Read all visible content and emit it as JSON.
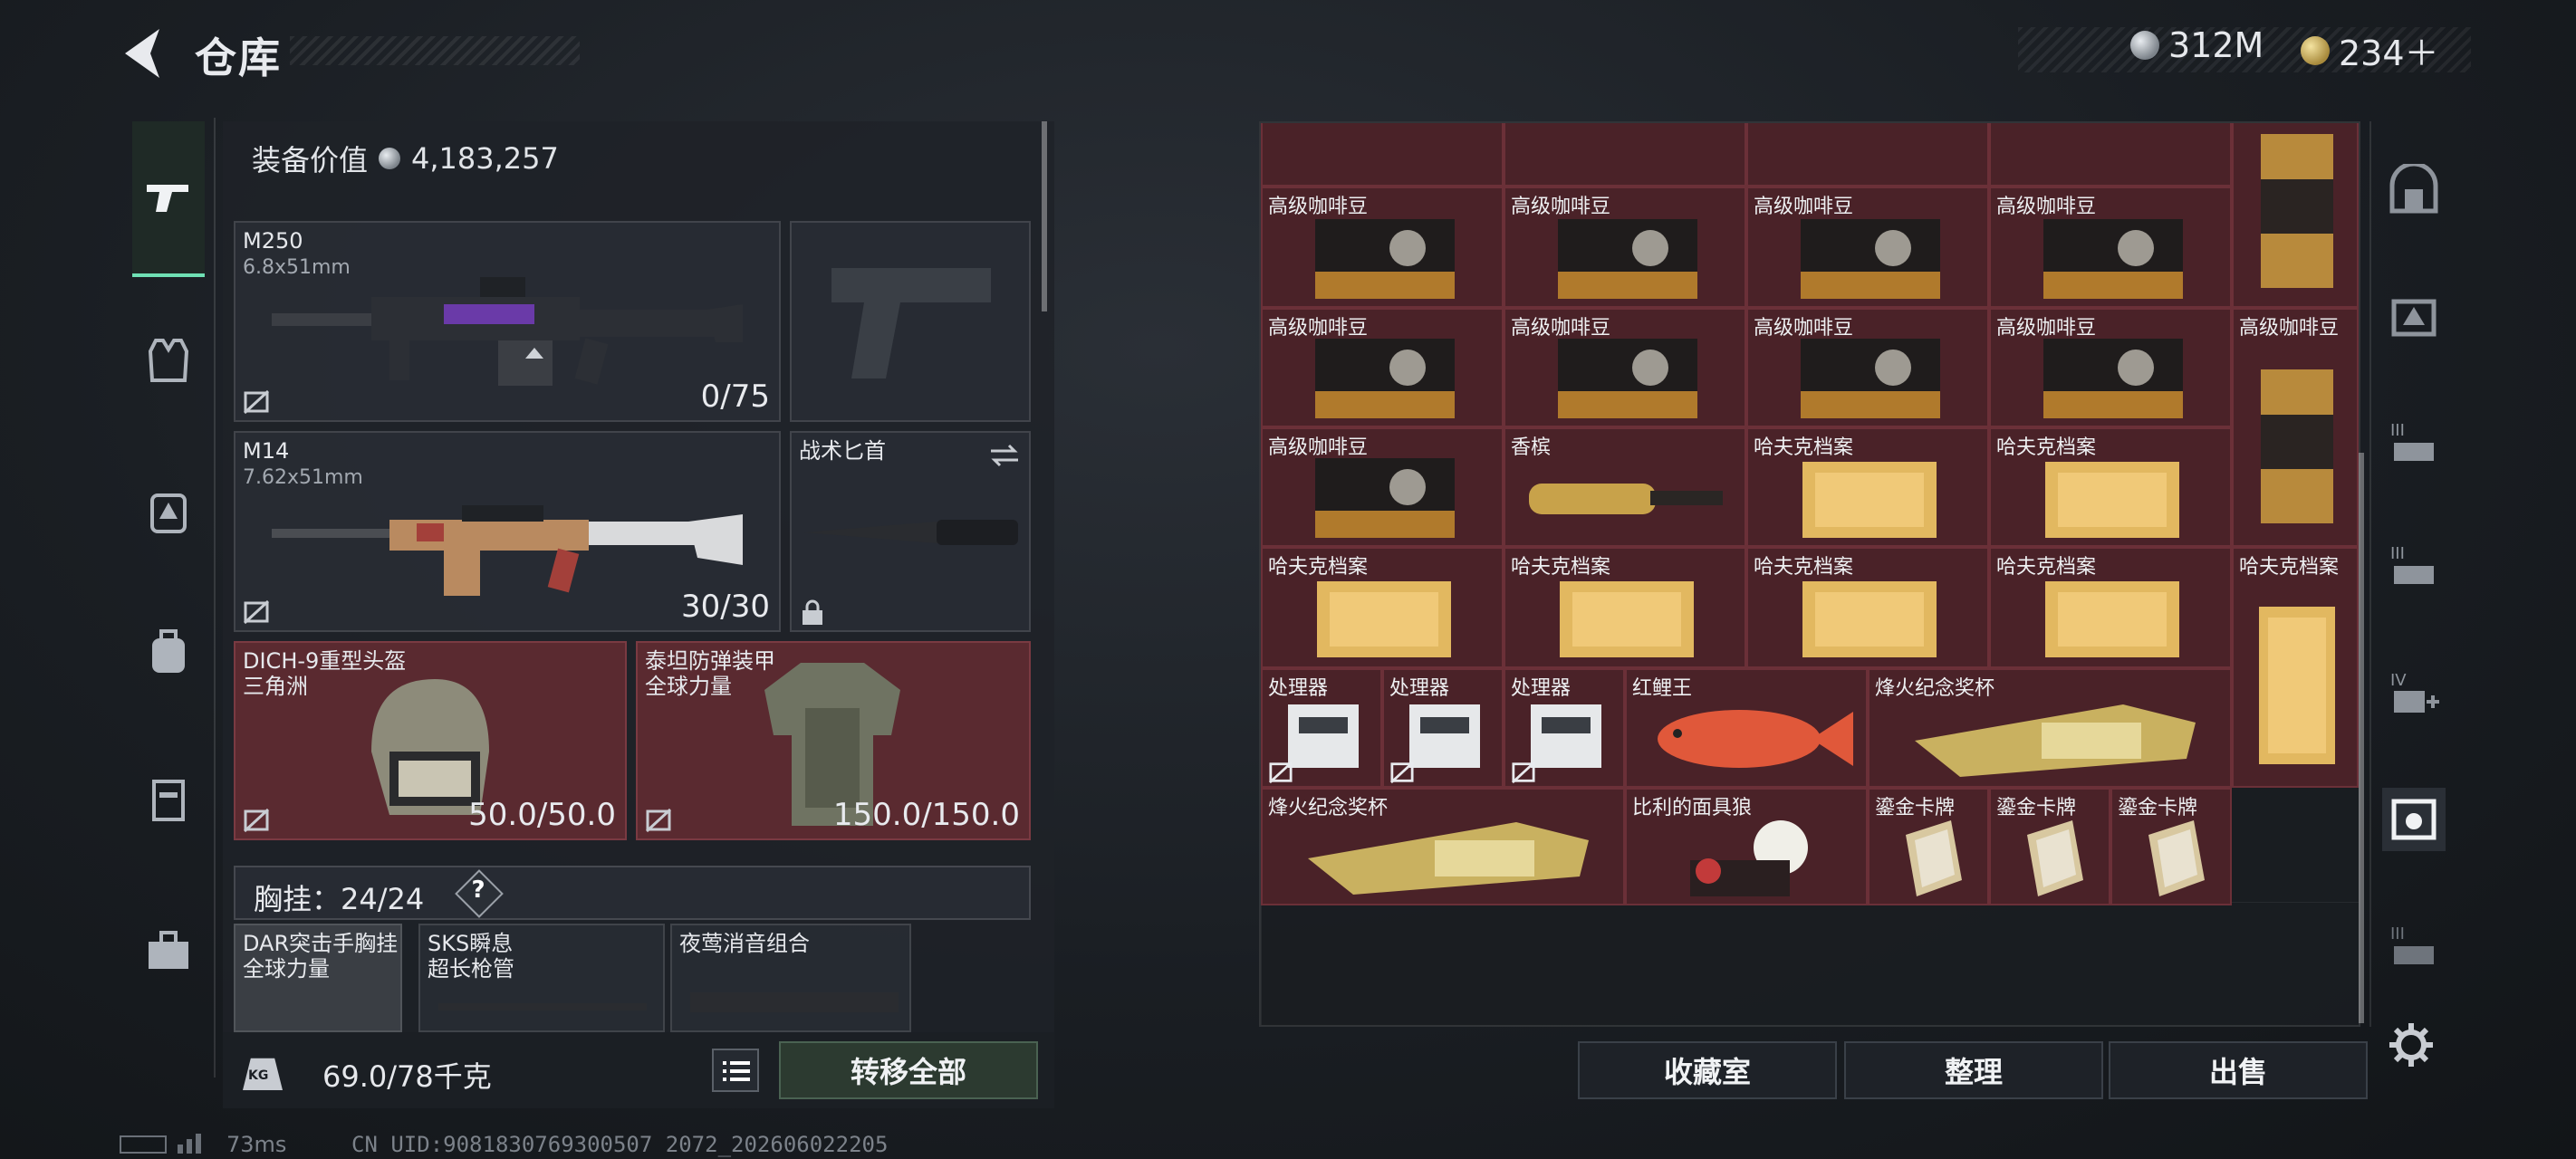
{
  "header": {
    "title": "仓库"
  },
  "currency": {
    "coins": "312M",
    "gold": "234＋"
  },
  "left_nav": [
    {
      "icon": "pistol-icon",
      "active": true
    },
    {
      "icon": "vest-icon",
      "active": false
    },
    {
      "icon": "backpack-alert-icon",
      "active": false
    },
    {
      "icon": "backpack-icon",
      "active": false
    },
    {
      "icon": "case-icon",
      "active": false
    },
    {
      "icon": "toolbox-icon",
      "active": false
    }
  ],
  "equipment": {
    "value_label": "装备价值",
    "value": "4,183,257",
    "primary": {
      "name": "M250",
      "caliber": "6.8x51mm",
      "ammo": "0/75"
    },
    "secondary": {
      "name": "M14",
      "caliber": "7.62x51mm",
      "ammo": "30/30"
    },
    "melee": {
      "name": "战术匕首"
    },
    "helmet": {
      "name": "DICH-9重型头盔",
      "origin": "三角洲",
      "durability": "50.0/50.0"
    },
    "armor": {
      "name": "泰坦防弹装甲",
      "origin": "全球力量",
      "durability": "150.0/150.0"
    },
    "rig": {
      "label": "胸挂：",
      "capacity": "24/24",
      "help": "?"
    },
    "rig_items": [
      {
        "name": "DAR突击手胸挂",
        "sub": "全球力量"
      },
      {
        "name": "SKS瞬息",
        "sub": "超长枪管"
      },
      {
        "name": "夜莺消音组合",
        "sub": ""
      }
    ],
    "weight": "69.0/78千克",
    "transfer_all": "转移全部"
  },
  "inventory": {
    "coffee": "高级咖啡豆",
    "champagne": "香槟",
    "huff_file": "哈夫克档案",
    "processor": "处理器",
    "red_carp": "红鲤王",
    "trophy": "烽火纪念奖杯",
    "billy_mask": "比利的面具狼",
    "gold_card": "鎏金卡牌"
  },
  "actions": {
    "collection": "收藏室",
    "sort": "整理",
    "sell": "出售"
  },
  "status": {
    "ping": "73ms",
    "uid": "CN UID:9081830769300507 2072_202606022205"
  },
  "colors": {
    "accent": "#6fe0b4",
    "item_bg": "#4a2228",
    "item_border": "#6b3038"
  }
}
